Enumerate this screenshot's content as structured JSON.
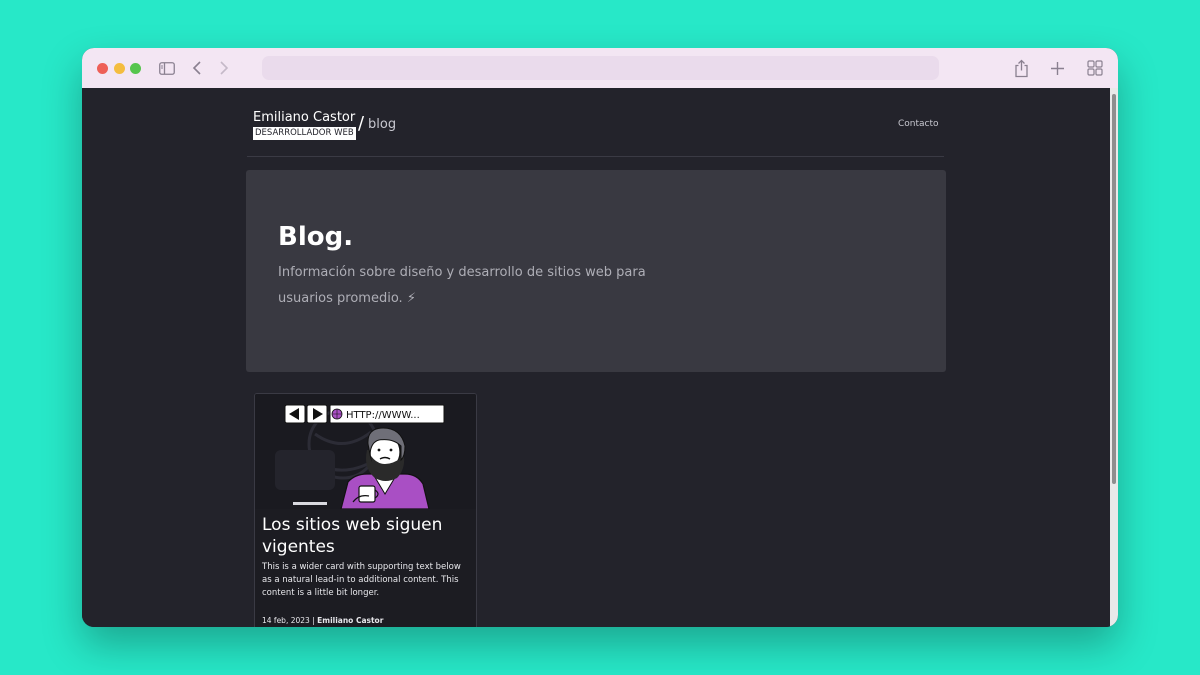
{
  "header": {
    "name": "Emiliano Castor",
    "tagline": "DESARROLLADOR WEB",
    "crumb_separator": "/",
    "crumb": "blog",
    "nav_contact": "Contacto"
  },
  "hero": {
    "title": "Blog.",
    "description": "Información sobre diseño y desarrollo de sitios web para usuarios promedio. ⚡"
  },
  "posts": [
    {
      "title": "Los sitios web siguen vigentes",
      "excerpt": "This is a wider card with supporting text below as a natural lead-in to additional content. This content is a little bit longer.",
      "date": "14 feb, 2023",
      "separator": "|",
      "author": "Emiliano Castor",
      "image_url_text": "HTTP://WWW..."
    }
  ],
  "colors": {
    "desktop_bg": "#27e8c8",
    "page_bg": "#23232b",
    "hero_bg": "#393941",
    "toolbar_bg": "#f3e6f3",
    "accent_purple": "#a94fc4"
  },
  "icons": [
    "sidebar-icon",
    "back-icon",
    "forward-icon",
    "share-icon",
    "new-tab-icon",
    "tab-overview-icon"
  ]
}
